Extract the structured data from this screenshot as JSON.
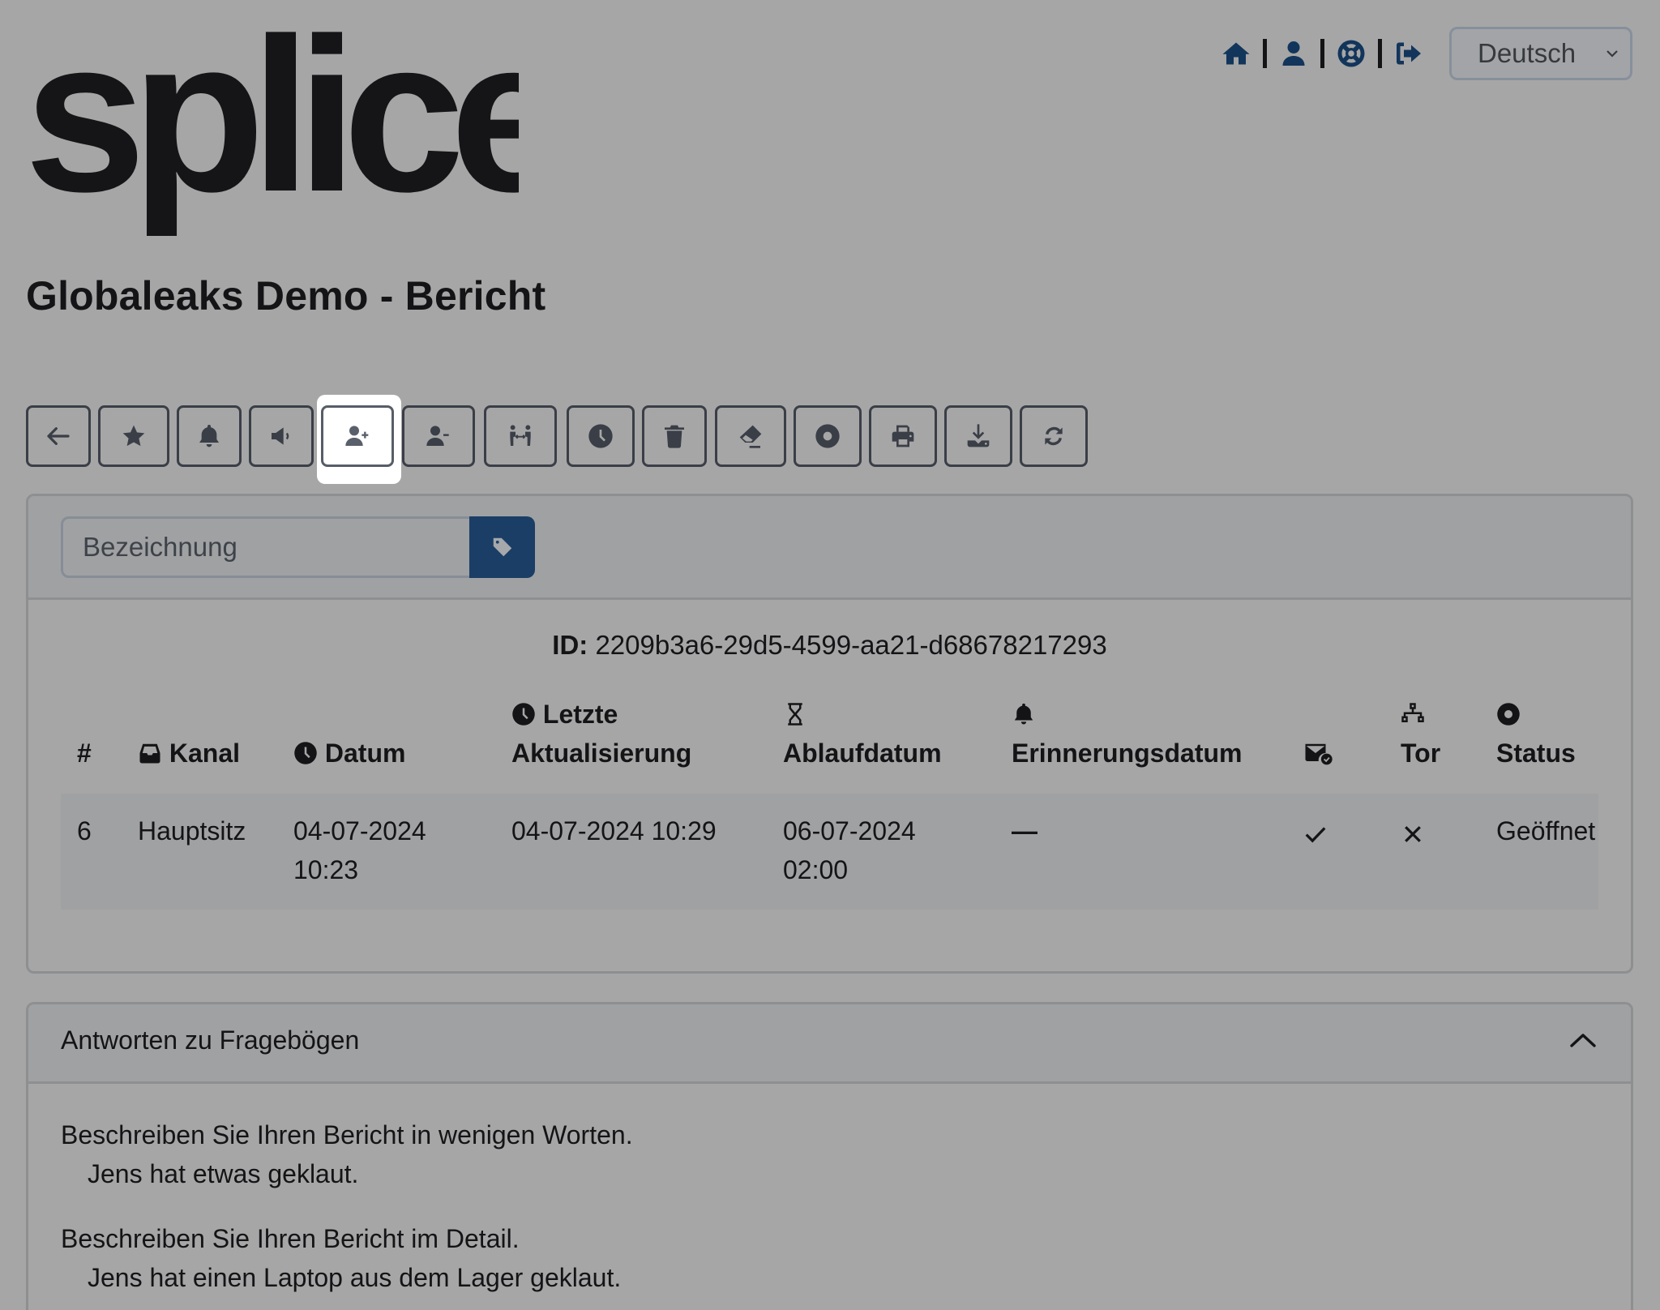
{
  "brand": {
    "logo_text": "splice"
  },
  "page_title": "Globaleaks Demo - Bericht",
  "topnav": {
    "icons": [
      "home-icon",
      "user-icon",
      "support-icon",
      "logout-icon"
    ],
    "language_select": {
      "value": "Deutsch"
    }
  },
  "toolbar": {
    "buttons": [
      {
        "name": "back-button",
        "icon": "arrow-left-icon"
      },
      {
        "name": "important-button",
        "icon": "star-icon"
      },
      {
        "name": "reminder-button",
        "icon": "bell-icon"
      },
      {
        "name": "notify-button",
        "icon": "megaphone-icon"
      },
      {
        "name": "grant-access-button",
        "icon": "user-plus-icon",
        "active": true
      },
      {
        "name": "revoke-access-button",
        "icon": "user-minus-icon"
      },
      {
        "name": "transfer-button",
        "icon": "people-arrows-icon"
      },
      {
        "name": "postpone-button",
        "icon": "clock-icon"
      },
      {
        "name": "delete-button",
        "icon": "trash-icon"
      },
      {
        "name": "redact-button",
        "icon": "eraser-icon"
      },
      {
        "name": "status-button",
        "icon": "circle-dot-icon"
      },
      {
        "name": "print-button",
        "icon": "print-icon"
      },
      {
        "name": "download-button",
        "icon": "download-icon"
      },
      {
        "name": "refresh-button",
        "icon": "refresh-icon"
      }
    ]
  },
  "label_form": {
    "placeholder": "Bezeichnung",
    "value": "",
    "button_icon": "tag-icon"
  },
  "report": {
    "id_label": "ID:",
    "id_value": "2209b3a6-29d5-4599-aa21-d68678217293",
    "columns": {
      "number": "#",
      "channel": "Kanal",
      "date": "Datum",
      "last_update_1": "Letzte",
      "last_update_2": "Aktualisierung",
      "expiration": "Ablaufdatum",
      "reminder": "Erinnerungsdatum",
      "tor": "Tor",
      "status": "Status"
    },
    "row": {
      "number": "6",
      "channel": "Hauptsitz",
      "date_1": "04-07-2024",
      "date_2": "10:23",
      "last_update": "04-07-2024 10:29",
      "expiration_1": "06-07-2024",
      "expiration_2": "02:00",
      "reminder": "—",
      "email_notified": true,
      "tor": false,
      "status": "Geöffnet"
    }
  },
  "questionnaire": {
    "title": "Antworten zu Fragebögen",
    "expanded": true,
    "answers": [
      {
        "question": "Beschreiben Sie Ihren Bericht in wenigen Worten.",
        "answer": "Jens hat etwas geklaut."
      },
      {
        "question": "Beschreiben Sie Ihren Bericht im Detail.",
        "answer": "Jens hat einen Laptop aus dem Lager geklaut."
      }
    ]
  }
}
